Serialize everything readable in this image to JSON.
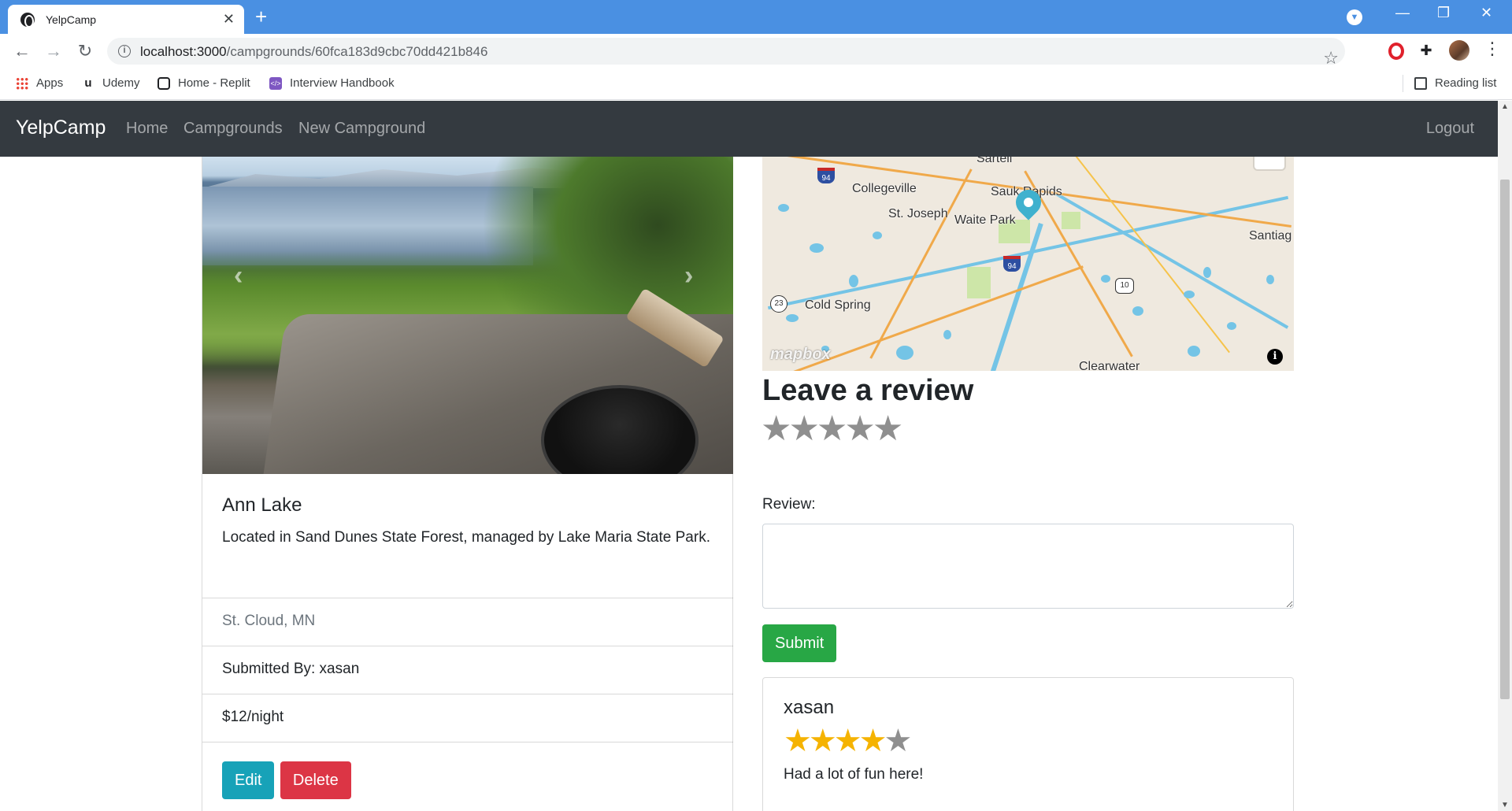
{
  "browser": {
    "tab_title": "YelpCamp",
    "url_host": "localhost:3000",
    "url_path": "/campgrounds/60fca183d9cbc70dd421b846",
    "bookmarks": [
      "Apps",
      "Udemy",
      "Home - Replit",
      "Interview Handbook"
    ],
    "reading_list": "Reading list"
  },
  "nav": {
    "brand": "YelpCamp",
    "links": [
      "Home",
      "Campgrounds",
      "New Campground"
    ],
    "logout": "Logout"
  },
  "campground": {
    "title": "Ann Lake",
    "description": "Located in Sand Dunes State Forest, managed by Lake Maria State Park.",
    "location": "St. Cloud, MN",
    "submitted_by": "Submitted By: xasan",
    "price": "$12/night",
    "edit_label": "Edit",
    "delete_label": "Delete"
  },
  "map": {
    "labels": [
      "Sartell",
      "Collegeville",
      "Sauk Rapids",
      "St. Joseph",
      "Waite Park",
      "Santiag",
      "Cold Spring",
      "Clearwater"
    ],
    "shields": [
      "94",
      "94",
      "10",
      "23"
    ],
    "attribution": "mapbox"
  },
  "review_form": {
    "heading": "Leave a review",
    "rating": 0,
    "max_rating": 5,
    "label": "Review:",
    "textarea_value": "",
    "submit_label": "Submit"
  },
  "reviews": [
    {
      "author": "xasan",
      "rating": 4,
      "max_rating": 5,
      "text": "Had a lot of fun here!"
    }
  ],
  "colors": {
    "navbar": "#343a40",
    "info": "#17a2b8",
    "danger": "#dc3545",
    "success": "#28a745",
    "star": "#f5b301",
    "tabstrip": "#4a90e2"
  }
}
